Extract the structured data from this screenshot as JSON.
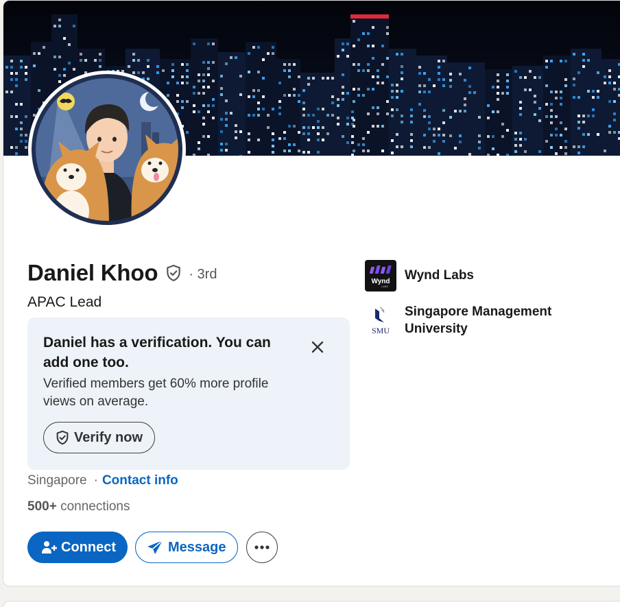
{
  "profile": {
    "name": "Daniel Khoo",
    "degree": "· 3rd",
    "headline": "APAC Lead",
    "location": "Singapore",
    "contact_link": "Contact info",
    "connections_count": "500+",
    "connections_label": "connections"
  },
  "verification": {
    "title": "Daniel has a verification. You can add one too.",
    "body": "Verified members get 60% more profile views on average.",
    "button_label": "Verify now"
  },
  "actions": {
    "connect_label": "Connect",
    "message_label": "Message"
  },
  "orgs": [
    {
      "name": "Wynd Labs",
      "logo_text": "Wynd",
      "logo_sub": "LABS"
    },
    {
      "name": "Singapore Management University",
      "logo_text": "SMU"
    }
  ],
  "colors": {
    "brand_blue": "#0a66c2",
    "verify_box_bg": "#edf3f8",
    "banner_bg": "#05070f"
  },
  "icons": {
    "verified": "shield-check-icon",
    "close": "close-icon",
    "connect": "add-person-icon",
    "message": "paper-plane-icon",
    "more": "ellipsis-icon"
  }
}
